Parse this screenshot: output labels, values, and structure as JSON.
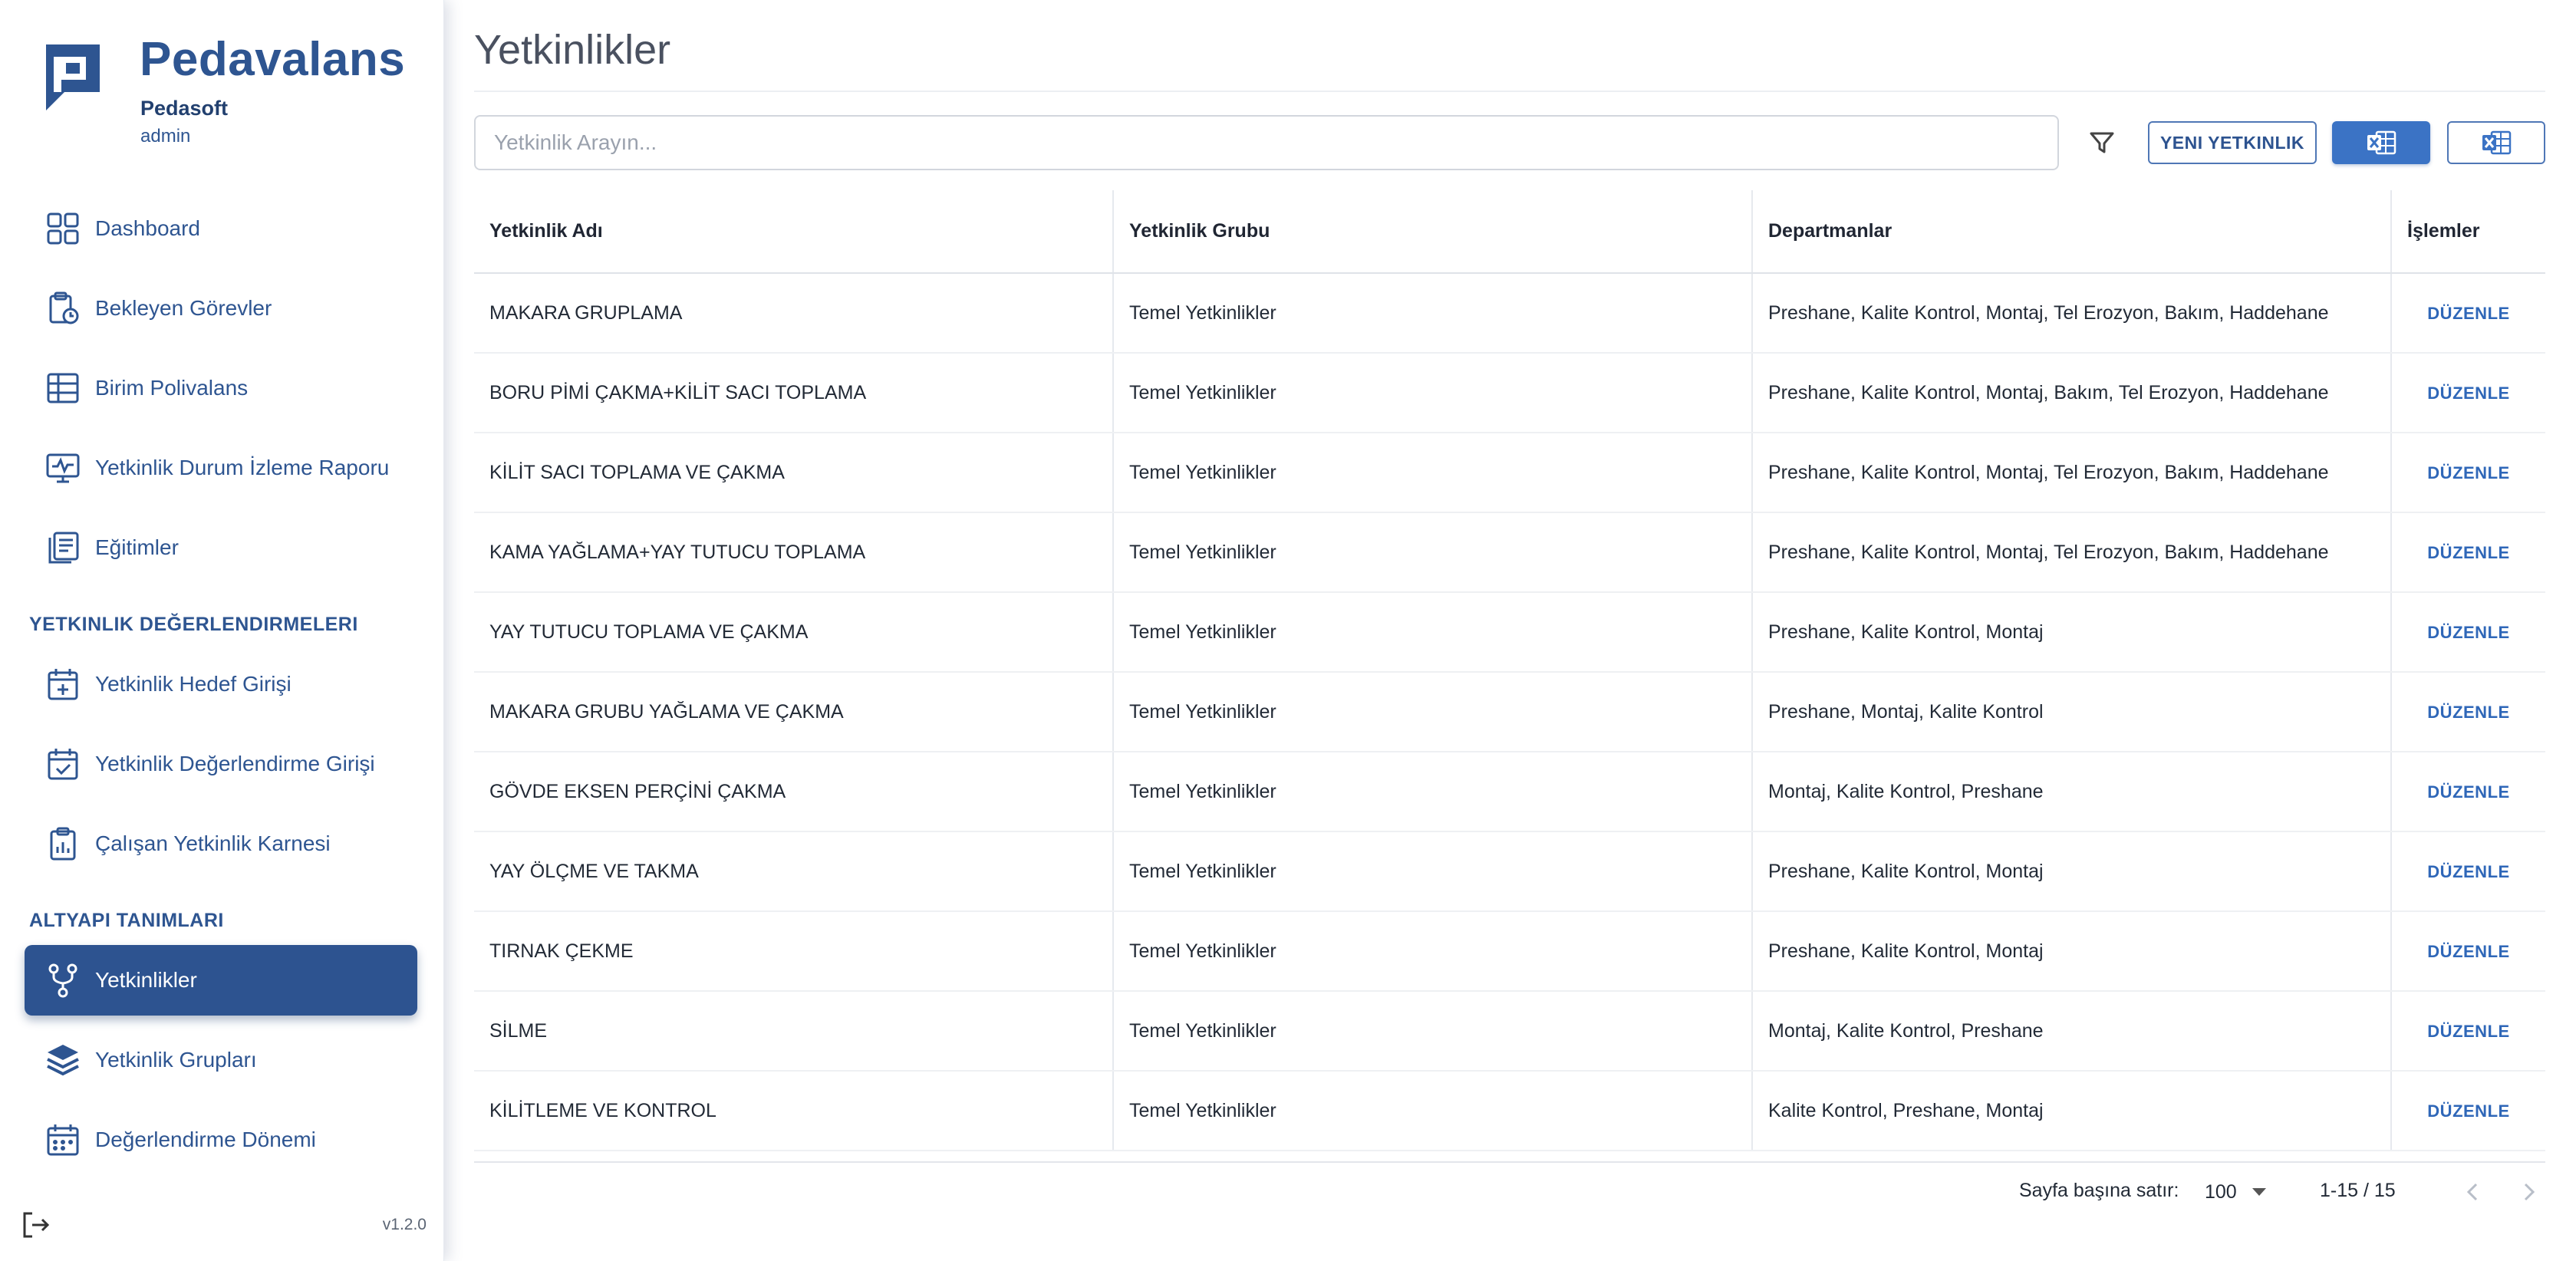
{
  "brand": {
    "name": "Pedavalans",
    "org": "Pedasoft",
    "user": "admin"
  },
  "nav": {
    "dashboard": "Dashboard",
    "pending": "Bekleyen Görevler",
    "unit_polyvalence": "Birim Polivalans",
    "report": "Yetkinlik Durum İzleme Raporu",
    "trainings": "Eğitimler",
    "section_eval": "YETKINLIK DEĞERLENDIRMELERI",
    "target_entry": "Yetkinlik Hedef Girişi",
    "eval_entry": "Yetkinlik Değerlendirme Girişi",
    "employee_card": "Çalışan Yetkinlik Karnesi",
    "section_infra": "ALTYAPI TANIMLARI",
    "competencies": "Yetkinlikler",
    "competency_groups": "Yetkinlik Grupları",
    "eval_period": "Değerlendirme Dönemi"
  },
  "version": "v1.2.0",
  "page": {
    "title": "Yetkinlikler"
  },
  "search": {
    "placeholder": "Yetkinlik Arayın..."
  },
  "toolbar": {
    "new_label": "YENI YETKINLIK"
  },
  "table": {
    "headers": {
      "name": "Yetkinlik Adı",
      "group": "Yetkinlik Grubu",
      "departments": "Departmanlar",
      "actions": "İşlemler"
    },
    "edit_label": "DÜZENLE",
    "rows": [
      {
        "name": "MAKARA GRUPLAMA",
        "group": "Temel Yetkinlikler",
        "departments": "Preshane, Kalite Kontrol, Montaj, Tel Erozyon, Bakım, Haddehane"
      },
      {
        "name": "BORU PİMİ ÇAKMA+KİLİT SACI TOPLAMA",
        "group": "Temel Yetkinlikler",
        "departments": "Preshane, Kalite Kontrol, Montaj, Bakım, Tel Erozyon, Haddehane"
      },
      {
        "name": "KİLİT SACI TOPLAMA VE ÇAKMA",
        "group": "Temel Yetkinlikler",
        "departments": "Preshane, Kalite Kontrol, Montaj, Tel Erozyon, Bakım, Haddehane"
      },
      {
        "name": "KAMA YAĞLAMA+YAY TUTUCU TOPLAMA",
        "group": "Temel Yetkinlikler",
        "departments": "Preshane, Kalite Kontrol, Montaj, Tel Erozyon, Bakım, Haddehane"
      },
      {
        "name": "YAY TUTUCU TOPLAMA VE ÇAKMA",
        "group": "Temel Yetkinlikler",
        "departments": "Preshane, Kalite Kontrol, Montaj"
      },
      {
        "name": "MAKARA GRUBU YAĞLAMA VE ÇAKMA",
        "group": "Temel Yetkinlikler",
        "departments": "Preshane, Montaj, Kalite Kontrol"
      },
      {
        "name": "GÖVDE EKSEN PERÇİNİ ÇAKMA",
        "group": "Temel Yetkinlikler",
        "departments": "Montaj, Kalite Kontrol, Preshane"
      },
      {
        "name": "YAY ÖLÇME VE TAKMA",
        "group": "Temel Yetkinlikler",
        "departments": "Preshane, Kalite Kontrol, Montaj"
      },
      {
        "name": "TIRNAK ÇEKME",
        "group": "Temel Yetkinlikler",
        "departments": "Preshane, Kalite Kontrol, Montaj"
      },
      {
        "name": "SİLME",
        "group": "Temel Yetkinlikler",
        "departments": "Montaj, Kalite Kontrol, Preshane"
      },
      {
        "name": "KİLİTLEME VE KONTROL",
        "group": "Temel Yetkinlikler",
        "departments": "Kalite Kontrol, Preshane, Montaj"
      }
    ]
  },
  "pagination": {
    "rows_label": "Sayfa başına satır:",
    "rows_per_page": "100",
    "range": "1-15 / 15"
  },
  "colors": {
    "primary": "#2d5390",
    "accent": "#3b73c5",
    "link": "#2f67b8"
  }
}
